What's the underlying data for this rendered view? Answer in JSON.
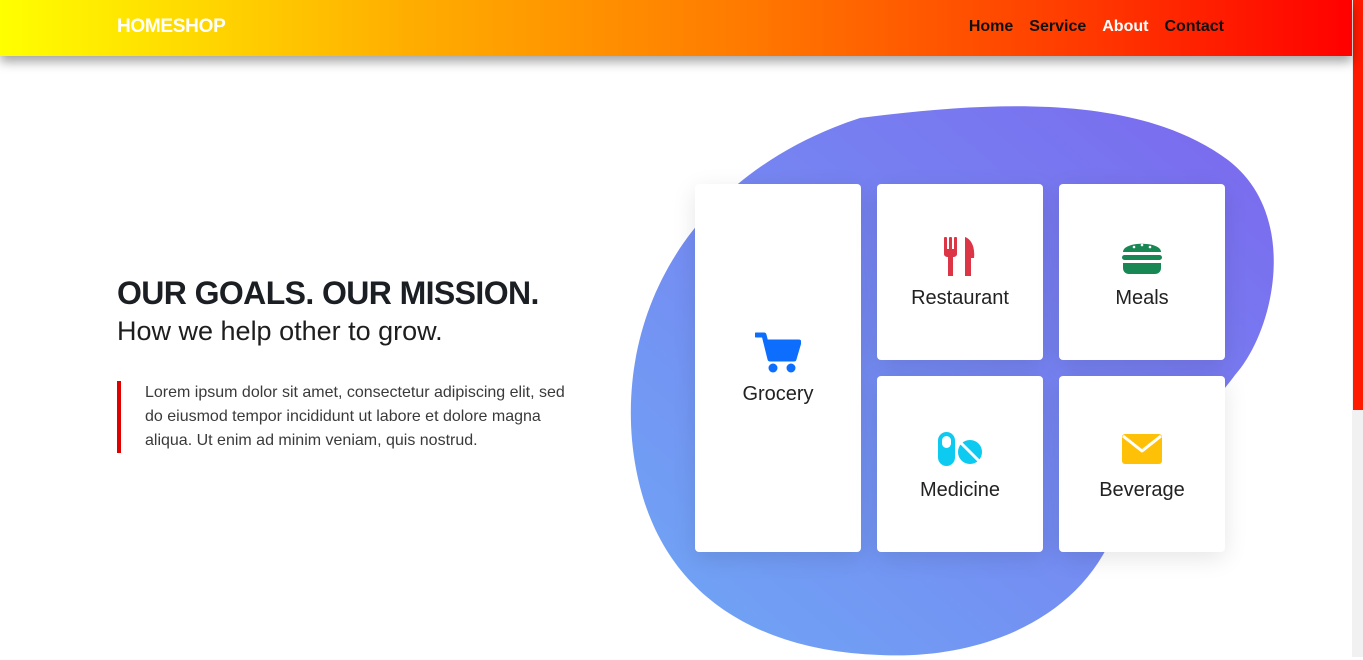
{
  "brand": "HOMESHOP",
  "nav": {
    "links": [
      {
        "label": "Home"
      },
      {
        "label": "Service"
      },
      {
        "label": "About"
      },
      {
        "label": "Contact"
      }
    ]
  },
  "hero": {
    "heading": "OUR GOALS. OUR MISSION.",
    "subheading": "How we help other to grow.",
    "description": "Lorem ipsum dolor sit amet, consectetur adipiscing elit, sed do eiusmod tempor incididunt ut labore et dolore magna aliqua. Ut enim ad minim veniam, quis nostrud."
  },
  "services": [
    {
      "label": "Grocery",
      "icon": "cart-icon",
      "color": "#0d6efd"
    },
    {
      "label": "Restaurant",
      "icon": "utensils-icon",
      "color": "#dc3545"
    },
    {
      "label": "Meals",
      "icon": "burger-icon",
      "color": "#198754"
    },
    {
      "label": "Medicine",
      "icon": "pills-icon",
      "color": "#0dcaf0"
    },
    {
      "label": "Beverage",
      "icon": "envelope-icon",
      "color": "#ffc107"
    }
  ],
  "colors": {
    "nav_gradient_start": "#ffff00",
    "nav_gradient_end": "#ff0000",
    "accent_bar": "#e00000",
    "blob_start": "#6fa8f5",
    "blob_end": "#7b68ee"
  }
}
